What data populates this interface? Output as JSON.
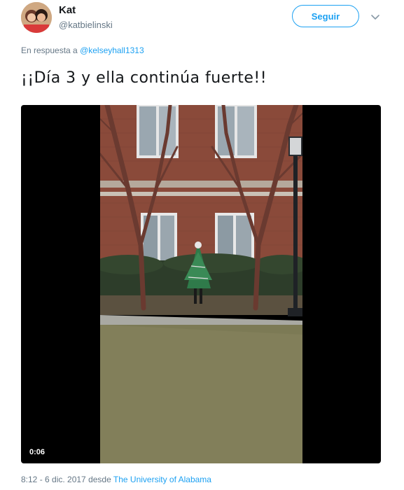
{
  "author": {
    "name": "Kat",
    "handle": "@katbielinski"
  },
  "follow_label": "Seguir",
  "reply": {
    "prefix": "En respuesta a",
    "mention": "@kelseyhall1313"
  },
  "tweet_text": "¡¡Día 3 y ella continúa fuerte!!",
  "video": {
    "elapsed": "0:06"
  },
  "meta": {
    "time": "8:12 - 6 dic. 2017",
    "via": "desde",
    "source": "The University of Alabama"
  },
  "icons": {
    "menu": "chevron-down-icon"
  },
  "colors": {
    "accent": "#1da1f2",
    "secondary_text": "#657786"
  }
}
